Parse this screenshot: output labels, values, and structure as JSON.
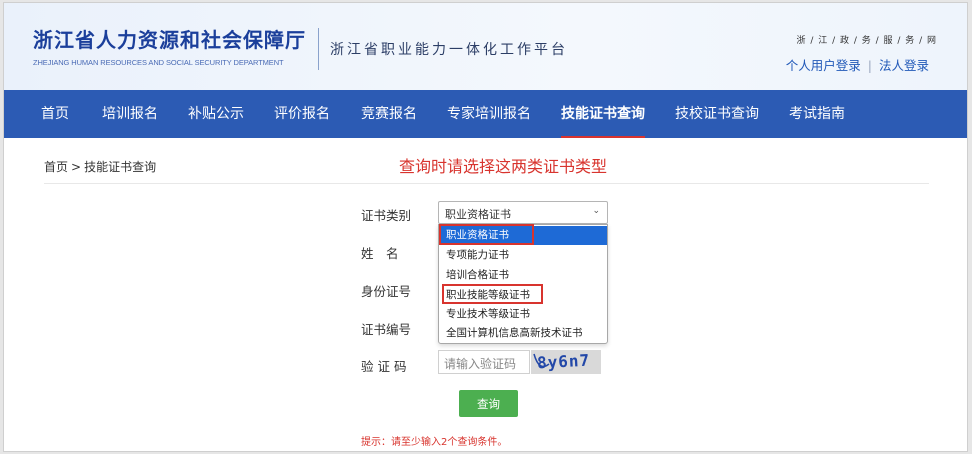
{
  "header": {
    "brand_cn": "浙江省人力资源和社会保障厅",
    "brand_en": "ZHEJIANG HUMAN RESOURCES AND SOCIAL SECURITY DEPARTMENT",
    "platform": "浙江省职业能力一体化工作平台",
    "gov_service": "浙 / 江 / 政 / 务 / 服 / 务 / 网",
    "personal_login": "个人用户登录",
    "login_separator": "|",
    "corporate_login": "法人登录"
  },
  "nav": {
    "items": [
      {
        "label": "首页",
        "active": false
      },
      {
        "label": "培训报名",
        "active": false
      },
      {
        "label": "补贴公示",
        "active": false
      },
      {
        "label": "评价报名",
        "active": false
      },
      {
        "label": "竞赛报名",
        "active": false
      },
      {
        "label": "专家培训报名",
        "active": false
      },
      {
        "label": "技能证书查询",
        "active": true
      },
      {
        "label": "技校证书查询",
        "active": false
      },
      {
        "label": "考试指南",
        "active": false
      }
    ]
  },
  "breadcrumb": {
    "home": "首页",
    "separator": ">",
    "current": "技能证书查询"
  },
  "notice": "查询时请选择这两类证书类型",
  "form": {
    "cert_type_label": "证书类别",
    "name_label": "姓　名",
    "id_label": "身份证号",
    "cert_no_label": "证书编号",
    "captcha_label": "验 证 码",
    "cert_type_value": "职业资格证书",
    "dropdown_chevron": "⌄",
    "options": [
      {
        "label": "职业资格证书",
        "selected": true,
        "highlighted": true
      },
      {
        "label": "专项能力证书",
        "selected": false,
        "highlighted": false
      },
      {
        "label": "培训合格证书",
        "selected": false,
        "highlighted": false
      },
      {
        "label": "职业技能等级证书",
        "selected": false,
        "highlighted": true
      },
      {
        "label": "专业技术等级证书",
        "selected": false,
        "highlighted": false
      },
      {
        "label": "全国计算机信息高新技术证书",
        "selected": false,
        "highlighted": false
      }
    ],
    "captcha_placeholder": "请输入验证码",
    "captcha_code": "8y6n7",
    "query_button": "查询",
    "hint": "提示：请至少输入2个查询条件。"
  },
  "colors": {
    "nav_bg": "#2c5bb4",
    "brand_blue": "#1b3f9b",
    "alert_red": "#d8342e",
    "button_green": "#4caf50",
    "selected_option": "#1e6ad6"
  }
}
